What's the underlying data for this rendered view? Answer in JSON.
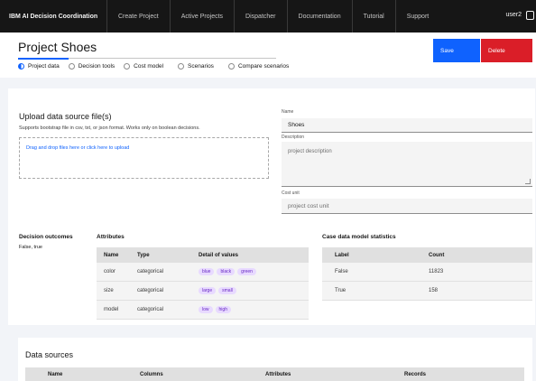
{
  "nav": {
    "brand": "IBM AI Decision Coordination",
    "items": [
      "Create Project",
      "Active Projects",
      "Dispatcher",
      "Documentation",
      "Tutorial",
      "Support"
    ],
    "user": "user2"
  },
  "header": {
    "title": "Project Shoes",
    "tabs": [
      "Project data",
      "Decision tools",
      "Cost model",
      "Scenarios",
      "Compare scenarios"
    ],
    "save_label": "Save",
    "delete_label": "Delete"
  },
  "upload": {
    "title": "Upload data source file(s)",
    "subtitle": "Supports bootstrap file in csv, txt, or json format. Works only on boolean decisions.",
    "dropzone_text": "Drag and drop files here or click here to upload"
  },
  "form": {
    "name_label": "Name",
    "name_value": "Shoes",
    "description_label": "Description",
    "description_placeholder": "project description",
    "cost_unit_label": "Cost unit",
    "cost_unit_placeholder": "project cost unit"
  },
  "outcomes": {
    "heading": "Decision outcomes",
    "value": "False, true"
  },
  "attributes": {
    "heading": "Attributes",
    "columns": [
      "Name",
      "Type",
      "Detail of values"
    ],
    "rows": [
      {
        "name": "color",
        "type": "categorical",
        "values": [
          "blue",
          "black",
          "green"
        ]
      },
      {
        "name": "size",
        "type": "categorical",
        "values": [
          "large",
          "small"
        ]
      },
      {
        "name": "model",
        "type": "categorical",
        "values": [
          "low",
          "high"
        ]
      }
    ]
  },
  "stats": {
    "heading": "Case data model statistics",
    "columns": [
      "Label",
      "Count"
    ],
    "rows": [
      {
        "label": "False",
        "count": "11823"
      },
      {
        "label": "True",
        "count": "158"
      }
    ]
  },
  "data_sources": {
    "title": "Data sources",
    "columns": [
      "Name",
      "Columns",
      "Attributes",
      "Records"
    ]
  },
  "colors": {
    "primary": "#0f62fe",
    "danger": "#da1e28",
    "tag_bg": "#e8daff",
    "tag_fg": "#6929c4"
  }
}
